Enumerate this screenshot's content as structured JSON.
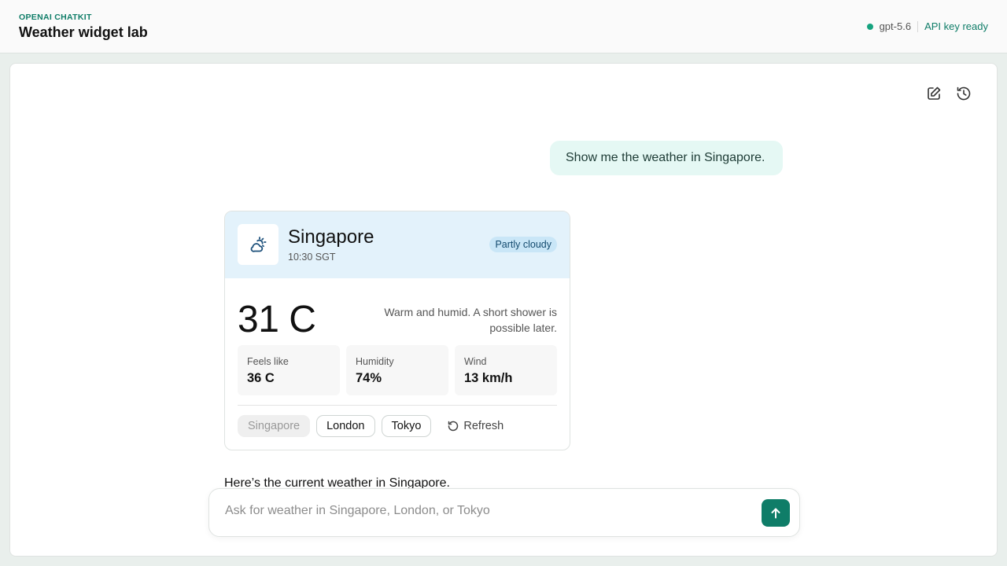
{
  "header": {
    "eyebrow": "OPENAI CHATKIT",
    "title": "Weather widget lab",
    "model": "gpt-5.6",
    "api_status": "API key ready",
    "status_color": "#16a37f"
  },
  "thread": {
    "user_message": "Show me the weather in Singapore.",
    "assistant_message": "Here’s the current weather in Singapore."
  },
  "weather_widget": {
    "icon": "partly-cloudy-icon",
    "city": "Singapore",
    "time": "10:30 SGT",
    "condition": "Partly cloudy",
    "temperature": "31 C",
    "summary": "Warm and humid. A short shower is possible later.",
    "stats": [
      {
        "label": "Feels like",
        "value": "36 C"
      },
      {
        "label": "Humidity",
        "value": "74%"
      },
      {
        "label": "Wind",
        "value": "13 km/h"
      }
    ],
    "city_buttons": [
      "Singapore",
      "London",
      "Tokyo"
    ],
    "selected_city": "Singapore",
    "refresh_label": "Refresh"
  },
  "composer": {
    "placeholder": "Ask for weather in Singapore, London, or Tokyo",
    "value": ""
  },
  "colors": {
    "accent": "#0f7d68",
    "widget_header_bg": "#e3f2fb",
    "user_bubble_bg": "#e5f8f4"
  }
}
